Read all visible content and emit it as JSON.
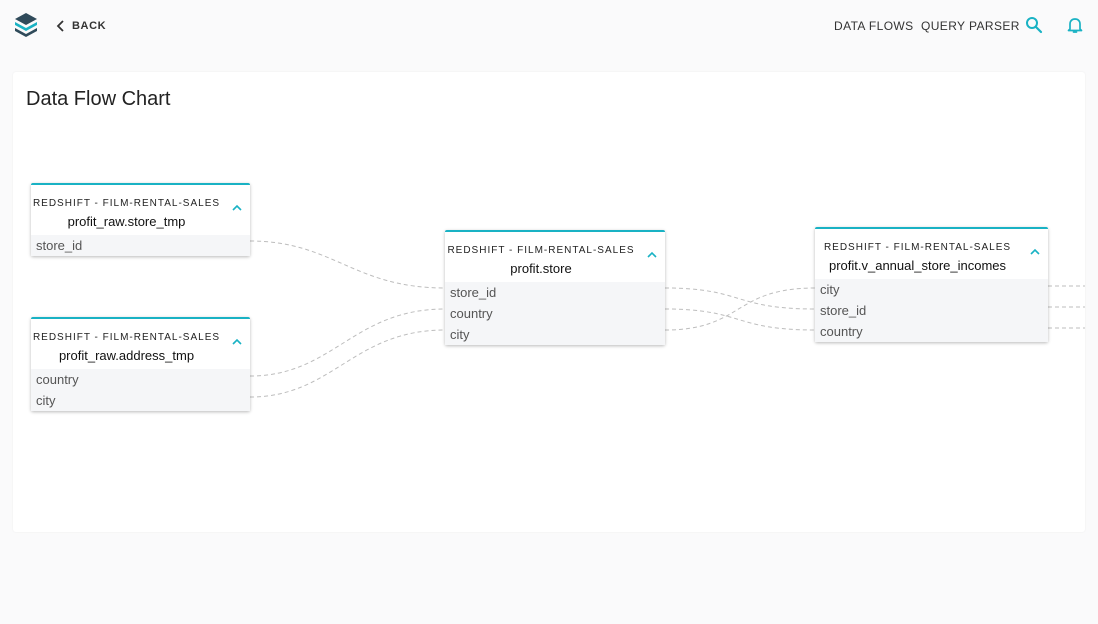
{
  "header": {
    "back_label": "BACK",
    "nav_data_flows": "DATA FLOWS",
    "nav_query_parser": "QUERY PARSER"
  },
  "colors": {
    "accent": "#19b2c4",
    "page_bg": "#fafafb",
    "field_bg": "#f5f6f8"
  },
  "icons": [
    "logo-icon",
    "chevron-left-icon",
    "search-icon",
    "bell-icon",
    "chevron-up-icon"
  ],
  "page": {
    "title": "Data Flow Chart"
  },
  "nodes": {
    "store_tmp": {
      "source": "REDSHIFT - FILM-RENTAL-SALES",
      "name": "profit_raw.store_tmp",
      "fields": [
        "store_id"
      ]
    },
    "address_tmp": {
      "source": "REDSHIFT - FILM-RENTAL-SALES",
      "name": "profit_raw.address_tmp",
      "fields": [
        "country",
        "city"
      ]
    },
    "store": {
      "source": "REDSHIFT - FILM-RENTAL-SALES",
      "name": "profit.store",
      "fields": [
        "store_id",
        "country",
        "city"
      ]
    },
    "annual": {
      "source": "REDSHIFT - FILM-RENTAL-SALES",
      "name": "profit.v_annual_store_incomes",
      "fields": [
        "city",
        "store_id",
        "country"
      ]
    }
  }
}
